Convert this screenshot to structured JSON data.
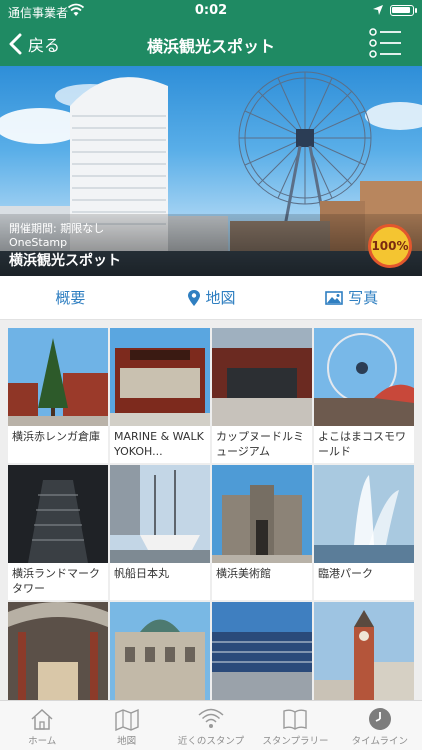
{
  "status": {
    "carrier": "通信事業者",
    "time": "0:02"
  },
  "nav": {
    "back_label": "戻る",
    "title": "横浜観光スポット"
  },
  "hero": {
    "period": "開催期間: 期限なし",
    "organizer": "OneStamp",
    "name": "横浜観光スポット",
    "progress": "100%"
  },
  "tabs": [
    {
      "label": "概要",
      "icon": "none"
    },
    {
      "label": "地図",
      "icon": "map-pin-icon"
    },
    {
      "label": "写真",
      "icon": "photo-icon"
    }
  ],
  "spots": [
    {
      "label": "横浜赤レンガ倉庫"
    },
    {
      "label": "MARINE & WALK YOKOH..."
    },
    {
      "label": "カップヌードルミュージアム"
    },
    {
      "label": "よこはまコスモワールド"
    },
    {
      "label": "横浜ランドマークタワー"
    },
    {
      "label": "帆船日本丸"
    },
    {
      "label": "横浜美術館"
    },
    {
      "label": "臨港パーク"
    },
    {
      "label": ""
    },
    {
      "label": ""
    },
    {
      "label": ""
    },
    {
      "label": ""
    }
  ],
  "bottom_tabs": [
    {
      "label": "ホーム",
      "icon": "home-icon"
    },
    {
      "label": "地図",
      "icon": "map-icon"
    },
    {
      "label": "近くのスタンプ",
      "icon": "signal-icon"
    },
    {
      "label": "スタンプラリー",
      "icon": "book-icon"
    },
    {
      "label": "タイムライン",
      "icon": "clock-icon"
    }
  ],
  "colors": {
    "header": "#1f8a63",
    "tab_text": "#2f7fc1",
    "badge": "#f4c531"
  }
}
